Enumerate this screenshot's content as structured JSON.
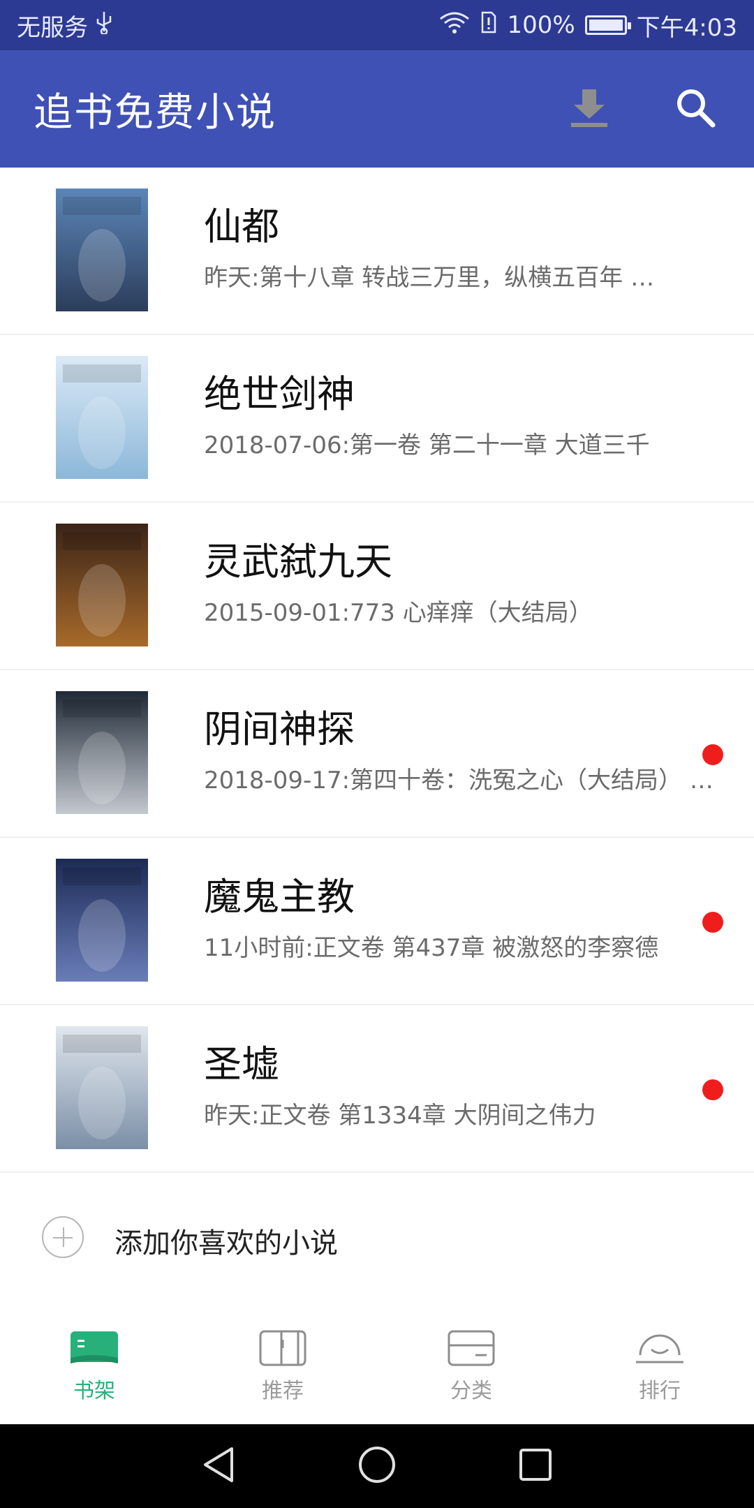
{
  "status_bar": {
    "carrier": "无服务",
    "battery": "100%",
    "time": "下午4:03",
    "icons": [
      "usb-icon",
      "wifi-icon",
      "sim-icon",
      "battery-icon"
    ]
  },
  "app_bar": {
    "title": "追书免费小说",
    "actions": [
      "download-icon",
      "search-icon"
    ]
  },
  "books": [
    {
      "title": "仙都",
      "latest": "昨天:第十八章 转战三万里，纵横五百年 …",
      "unread": false,
      "cover_colors": [
        "#5b86b8",
        "#2c3d5a"
      ]
    },
    {
      "title": "绝世剑神",
      "latest": "2018-07-06:第一卷 第二十一章 大道三千",
      "unread": false,
      "cover_colors": [
        "#dbeaf6",
        "#8cb7d9"
      ]
    },
    {
      "title": "灵武弑九天",
      "latest": "2015-09-01:773 心痒痒（大结局）",
      "unread": false,
      "cover_colors": [
        "#3a2418",
        "#a86a2a"
      ]
    },
    {
      "title": "阴间神探",
      "latest": "2018-09-17:第四十卷：洗冤之心（大结局） …",
      "unread": true,
      "cover_colors": [
        "#1f2a36",
        "#c4c8cf"
      ]
    },
    {
      "title": "魔鬼主教",
      "latest": "11小时前:正文卷 第437章 被激怒的李察德",
      "unread": true,
      "cover_colors": [
        "#1c2a55",
        "#6a7db8"
      ]
    },
    {
      "title": "圣墟",
      "latest": "昨天:正文卷 第1334章 大阴间之伟力",
      "unread": true,
      "cover_colors": [
        "#dfe6ee",
        "#7b8fa6"
      ]
    }
  ],
  "add_row": {
    "label": "添加你喜欢的小说"
  },
  "bottom_nav": [
    {
      "label": "书架",
      "icon": "bookshelf-icon",
      "active": true
    },
    {
      "label": "推荐",
      "icon": "recommend-icon",
      "active": false
    },
    {
      "label": "分类",
      "icon": "category-icon",
      "active": false
    },
    {
      "label": "排行",
      "icon": "ranking-icon",
      "active": false
    }
  ],
  "colors": {
    "status_bar": "#2d3a93",
    "app_bar": "#3f51b5",
    "active_nav": "#27b07a",
    "unread_dot": "#f01d1d"
  }
}
